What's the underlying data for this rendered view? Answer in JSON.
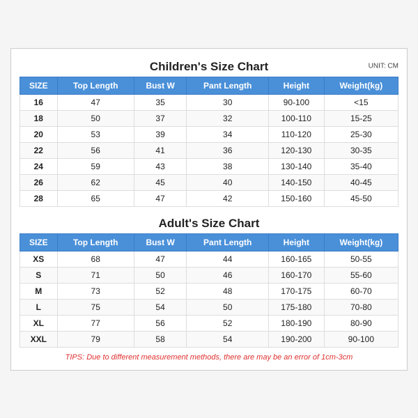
{
  "children_title": "Children's Size Chart",
  "adult_title": "Adult's Size Chart",
  "unit_label": "UNIT: CM",
  "headers": [
    "SIZE",
    "Top Length",
    "Bust W",
    "Pant Length",
    "Height",
    "Weight(kg)"
  ],
  "children_rows": [
    [
      "16",
      "47",
      "35",
      "30",
      "90-100",
      "<15"
    ],
    [
      "18",
      "50",
      "37",
      "32",
      "100-110",
      "15-25"
    ],
    [
      "20",
      "53",
      "39",
      "34",
      "110-120",
      "25-30"
    ],
    [
      "22",
      "56",
      "41",
      "36",
      "120-130",
      "30-35"
    ],
    [
      "24",
      "59",
      "43",
      "38",
      "130-140",
      "35-40"
    ],
    [
      "26",
      "62",
      "45",
      "40",
      "140-150",
      "40-45"
    ],
    [
      "28",
      "65",
      "47",
      "42",
      "150-160",
      "45-50"
    ]
  ],
  "adult_rows": [
    [
      "XS",
      "68",
      "47",
      "44",
      "160-165",
      "50-55"
    ],
    [
      "S",
      "71",
      "50",
      "46",
      "160-170",
      "55-60"
    ],
    [
      "M",
      "73",
      "52",
      "48",
      "170-175",
      "60-70"
    ],
    [
      "L",
      "75",
      "54",
      "50",
      "175-180",
      "70-80"
    ],
    [
      "XL",
      "77",
      "56",
      "52",
      "180-190",
      "80-90"
    ],
    [
      "XXL",
      "79",
      "58",
      "54",
      "190-200",
      "90-100"
    ]
  ],
  "tips": "TIPS: Due to different measurement methods, there are may be an error of 1cm-3cm"
}
